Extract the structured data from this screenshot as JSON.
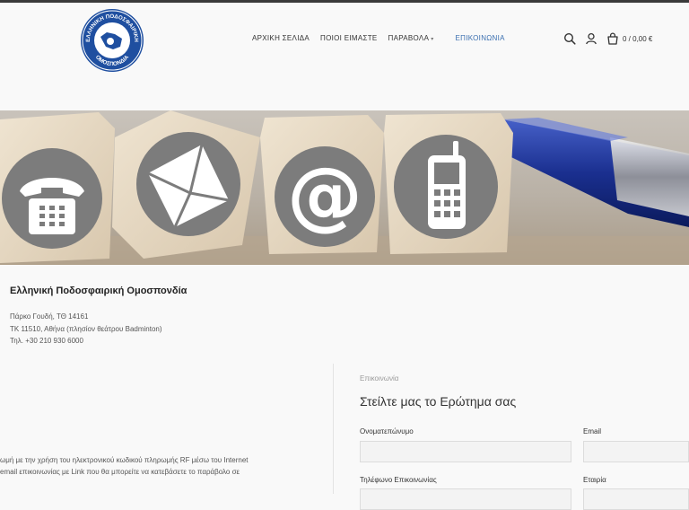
{
  "nav": {
    "items": [
      {
        "label": "ΑΡΧΙΚΗ ΣΕΛΙΔΑ"
      },
      {
        "label": "ΠΟΙΟΙ ΕΙΜΑΣΤΕ"
      },
      {
        "label": "ΠΑΡΑΒΟΛΑ"
      },
      {
        "label": "ΕΠΙΚΟΙΝΩΝΙΑ"
      }
    ],
    "active_color": "#3a6fb0"
  },
  "header": {
    "cart_total": "0 / 0,00 €"
  },
  "logo": {
    "text_top": "ΕΛΛΗΝΙΚΗ ΠΟΔΟΣΦΑΙΡΙΚΗ",
    "text_bottom": "ΟΜΟΣΠΟΝΔΙΑ",
    "color": "#1f4fa0"
  },
  "info": {
    "org_name": "Ελληνική Ποδοσφαιρική Ομοσπονδία",
    "address_line1": "Πάρκο Γουδή, ΤΘ 14161",
    "address_line2": "ΤΚ 11510, Αθήνα (πλησίον θεάτρου Badminton)",
    "phone": "Τηλ. +30 210 930 6000"
  },
  "left_text": {
    "line1": "ωμή με την χρήση του ηλεκτρονικού κωδικού πληρωμής RF μέσω του Internet",
    "line2": "email επικοινωνίας με Link που θα μπορείτε να κατεβάσετε το παράβολο σε"
  },
  "form": {
    "eyebrow": "Επικοινωνία",
    "title": "Στείλτε μας το Ερώτημα σας",
    "fullname_label": "Ονοματεπώνυμο",
    "email_label": "Email",
    "phone_label": "Τηλέφωνο Επικοινωνίας",
    "company_label": "Εταιρία"
  }
}
